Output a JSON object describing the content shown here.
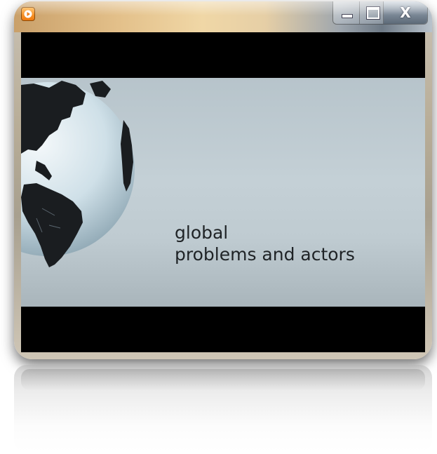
{
  "window": {
    "app_icon": "media-player-icon",
    "controls": {
      "minimize_icon": "minimize-icon",
      "maximize_icon": "maximize-icon",
      "close_label": "X"
    }
  },
  "video": {
    "caption_line1": "global",
    "caption_line2": "problems and actors",
    "visual": "globe-icon"
  },
  "colors": {
    "letterbox": "#000000",
    "background": "#bfcbd1",
    "caption_text": "#1f2326",
    "titlebar_accent": "#e3c08a"
  }
}
